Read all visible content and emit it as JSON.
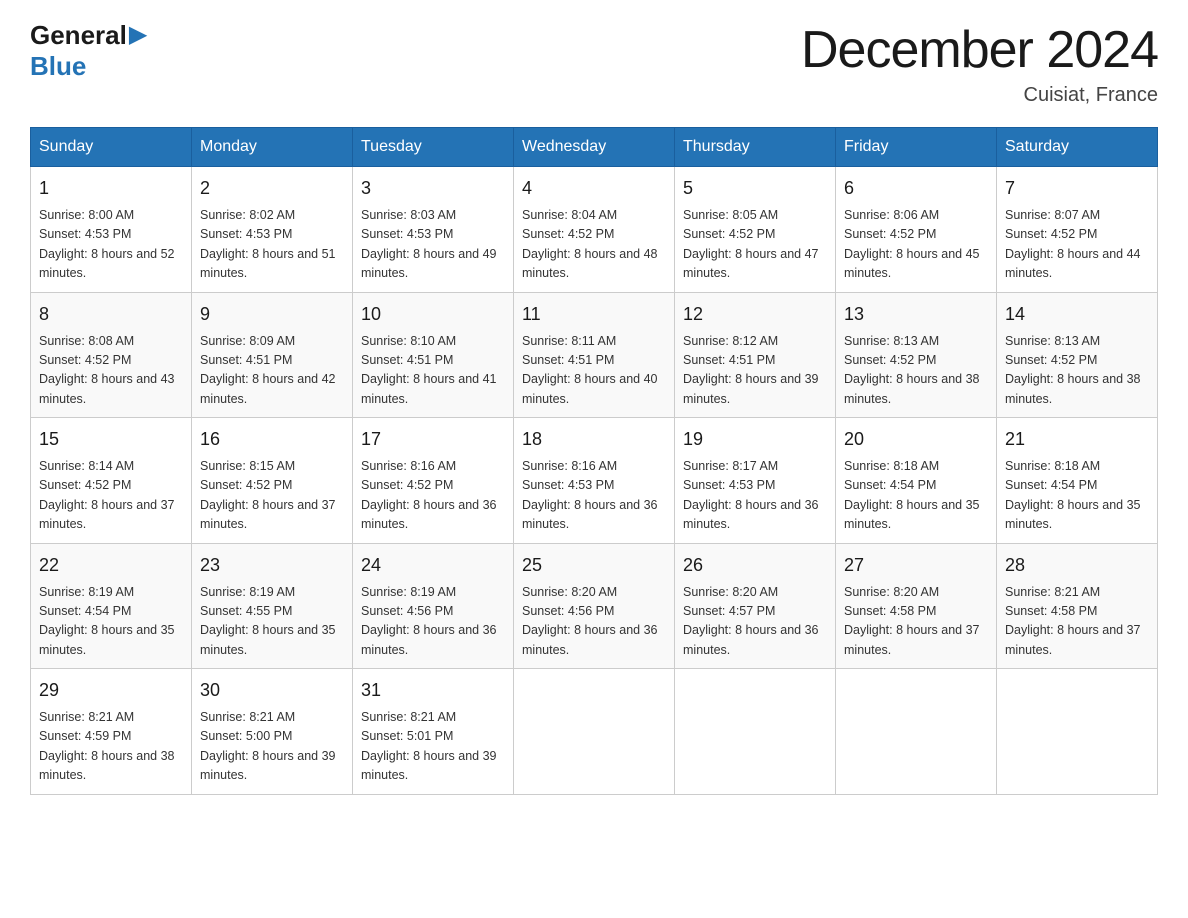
{
  "header": {
    "logo_general": "General",
    "logo_arrow": "▶",
    "logo_blue": "Blue",
    "month_title": "December 2024",
    "location": "Cuisiat, France"
  },
  "days_of_week": [
    "Sunday",
    "Monday",
    "Tuesday",
    "Wednesday",
    "Thursday",
    "Friday",
    "Saturday"
  ],
  "weeks": [
    [
      {
        "day": "1",
        "sunrise": "8:00 AM",
        "sunset": "4:53 PM",
        "daylight": "8 hours and 52 minutes."
      },
      {
        "day": "2",
        "sunrise": "8:02 AM",
        "sunset": "4:53 PM",
        "daylight": "8 hours and 51 minutes."
      },
      {
        "day": "3",
        "sunrise": "8:03 AM",
        "sunset": "4:53 PM",
        "daylight": "8 hours and 49 minutes."
      },
      {
        "day": "4",
        "sunrise": "8:04 AM",
        "sunset": "4:52 PM",
        "daylight": "8 hours and 48 minutes."
      },
      {
        "day": "5",
        "sunrise": "8:05 AM",
        "sunset": "4:52 PM",
        "daylight": "8 hours and 47 minutes."
      },
      {
        "day": "6",
        "sunrise": "8:06 AM",
        "sunset": "4:52 PM",
        "daylight": "8 hours and 45 minutes."
      },
      {
        "day": "7",
        "sunrise": "8:07 AM",
        "sunset": "4:52 PM",
        "daylight": "8 hours and 44 minutes."
      }
    ],
    [
      {
        "day": "8",
        "sunrise": "8:08 AM",
        "sunset": "4:52 PM",
        "daylight": "8 hours and 43 minutes."
      },
      {
        "day": "9",
        "sunrise": "8:09 AM",
        "sunset": "4:51 PM",
        "daylight": "8 hours and 42 minutes."
      },
      {
        "day": "10",
        "sunrise": "8:10 AM",
        "sunset": "4:51 PM",
        "daylight": "8 hours and 41 minutes."
      },
      {
        "day": "11",
        "sunrise": "8:11 AM",
        "sunset": "4:51 PM",
        "daylight": "8 hours and 40 minutes."
      },
      {
        "day": "12",
        "sunrise": "8:12 AM",
        "sunset": "4:51 PM",
        "daylight": "8 hours and 39 minutes."
      },
      {
        "day": "13",
        "sunrise": "8:13 AM",
        "sunset": "4:52 PM",
        "daylight": "8 hours and 38 minutes."
      },
      {
        "day": "14",
        "sunrise": "8:13 AM",
        "sunset": "4:52 PM",
        "daylight": "8 hours and 38 minutes."
      }
    ],
    [
      {
        "day": "15",
        "sunrise": "8:14 AM",
        "sunset": "4:52 PM",
        "daylight": "8 hours and 37 minutes."
      },
      {
        "day": "16",
        "sunrise": "8:15 AM",
        "sunset": "4:52 PM",
        "daylight": "8 hours and 37 minutes."
      },
      {
        "day": "17",
        "sunrise": "8:16 AM",
        "sunset": "4:52 PM",
        "daylight": "8 hours and 36 minutes."
      },
      {
        "day": "18",
        "sunrise": "8:16 AM",
        "sunset": "4:53 PM",
        "daylight": "8 hours and 36 minutes."
      },
      {
        "day": "19",
        "sunrise": "8:17 AM",
        "sunset": "4:53 PM",
        "daylight": "8 hours and 36 minutes."
      },
      {
        "day": "20",
        "sunrise": "8:18 AM",
        "sunset": "4:54 PM",
        "daylight": "8 hours and 35 minutes."
      },
      {
        "day": "21",
        "sunrise": "8:18 AM",
        "sunset": "4:54 PM",
        "daylight": "8 hours and 35 minutes."
      }
    ],
    [
      {
        "day": "22",
        "sunrise": "8:19 AM",
        "sunset": "4:54 PM",
        "daylight": "8 hours and 35 minutes."
      },
      {
        "day": "23",
        "sunrise": "8:19 AM",
        "sunset": "4:55 PM",
        "daylight": "8 hours and 35 minutes."
      },
      {
        "day": "24",
        "sunrise": "8:19 AM",
        "sunset": "4:56 PM",
        "daylight": "8 hours and 36 minutes."
      },
      {
        "day": "25",
        "sunrise": "8:20 AM",
        "sunset": "4:56 PM",
        "daylight": "8 hours and 36 minutes."
      },
      {
        "day": "26",
        "sunrise": "8:20 AM",
        "sunset": "4:57 PM",
        "daylight": "8 hours and 36 minutes."
      },
      {
        "day": "27",
        "sunrise": "8:20 AM",
        "sunset": "4:58 PM",
        "daylight": "8 hours and 37 minutes."
      },
      {
        "day": "28",
        "sunrise": "8:21 AM",
        "sunset": "4:58 PM",
        "daylight": "8 hours and 37 minutes."
      }
    ],
    [
      {
        "day": "29",
        "sunrise": "8:21 AM",
        "sunset": "4:59 PM",
        "daylight": "8 hours and 38 minutes."
      },
      {
        "day": "30",
        "sunrise": "8:21 AM",
        "sunset": "5:00 PM",
        "daylight": "8 hours and 39 minutes."
      },
      {
        "day": "31",
        "sunrise": "8:21 AM",
        "sunset": "5:01 PM",
        "daylight": "8 hours and 39 minutes."
      },
      null,
      null,
      null,
      null
    ]
  ],
  "labels": {
    "sunrise_prefix": "Sunrise: ",
    "sunset_prefix": "Sunset: ",
    "daylight_prefix": "Daylight: "
  }
}
